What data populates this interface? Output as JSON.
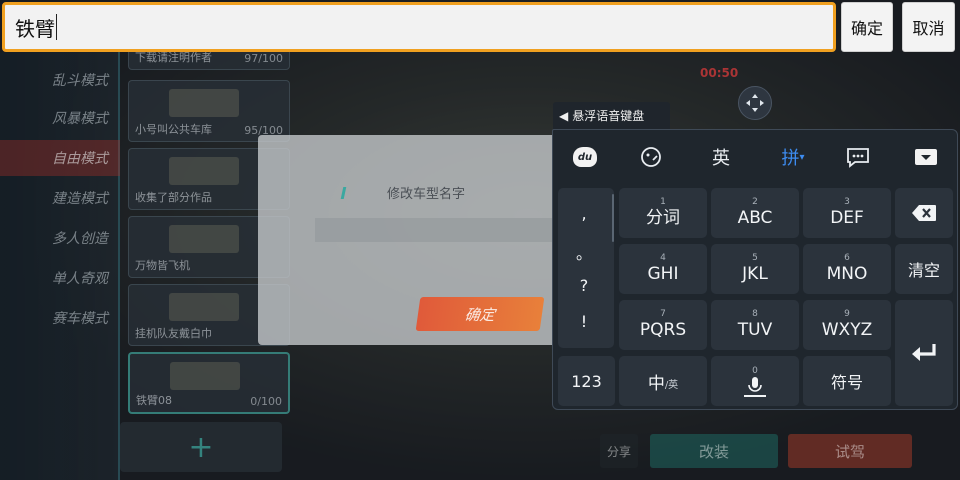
{
  "top_bar": {
    "input_value": "铁臂",
    "confirm_label": "确定",
    "cancel_label": "取消"
  },
  "game": {
    "modes": [
      "乱斗模式",
      "风暴模式",
      "自由模式",
      "建造模式",
      "多人创造",
      "单人奇观",
      "赛车模式"
    ],
    "cars": [
      {
        "name": "下载请注明作者",
        "count": "97/100"
      },
      {
        "name": "小号叫公共车库",
        "count": "95/100"
      },
      {
        "name": "收集了部分作品",
        "count": ""
      },
      {
        "name": "万物皆飞机",
        "count": ""
      },
      {
        "name": "挂机队友戴白巾",
        "count": ""
      },
      {
        "name": "铁臂08",
        "count": "0/100"
      }
    ],
    "add_label": "+",
    "timer": "00:50",
    "share_label": "分享",
    "modify_label": "改装",
    "test_label": "试驾"
  },
  "rename_dialog": {
    "title": "修改车型名字",
    "confirm_label": "确定"
  },
  "keyboard": {
    "voice_tab_label": "悬浮语音键盘",
    "toolbar": {
      "logo": "du",
      "english": "英",
      "pinyin": "拼",
      "pinyin_caret": "▾"
    },
    "punctuation": [
      ",",
      "。",
      "?",
      "!"
    ],
    "keys": [
      {
        "num": "1",
        "label": "分词"
      },
      {
        "num": "2",
        "label": "ABC"
      },
      {
        "num": "3",
        "label": "DEF"
      },
      {
        "num": "4",
        "label": "GHI"
      },
      {
        "num": "5",
        "label": "JKL"
      },
      {
        "num": "6",
        "label": "MNO"
      },
      {
        "num": "7",
        "label": "PQRS"
      },
      {
        "num": "8",
        "label": "TUV"
      },
      {
        "num": "9",
        "label": "WXYZ"
      }
    ],
    "clear_label": "清空",
    "num_label": "123",
    "lang_main": "中",
    "lang_sub": "/英",
    "space_num": "0",
    "symbol_label": "符号"
  }
}
